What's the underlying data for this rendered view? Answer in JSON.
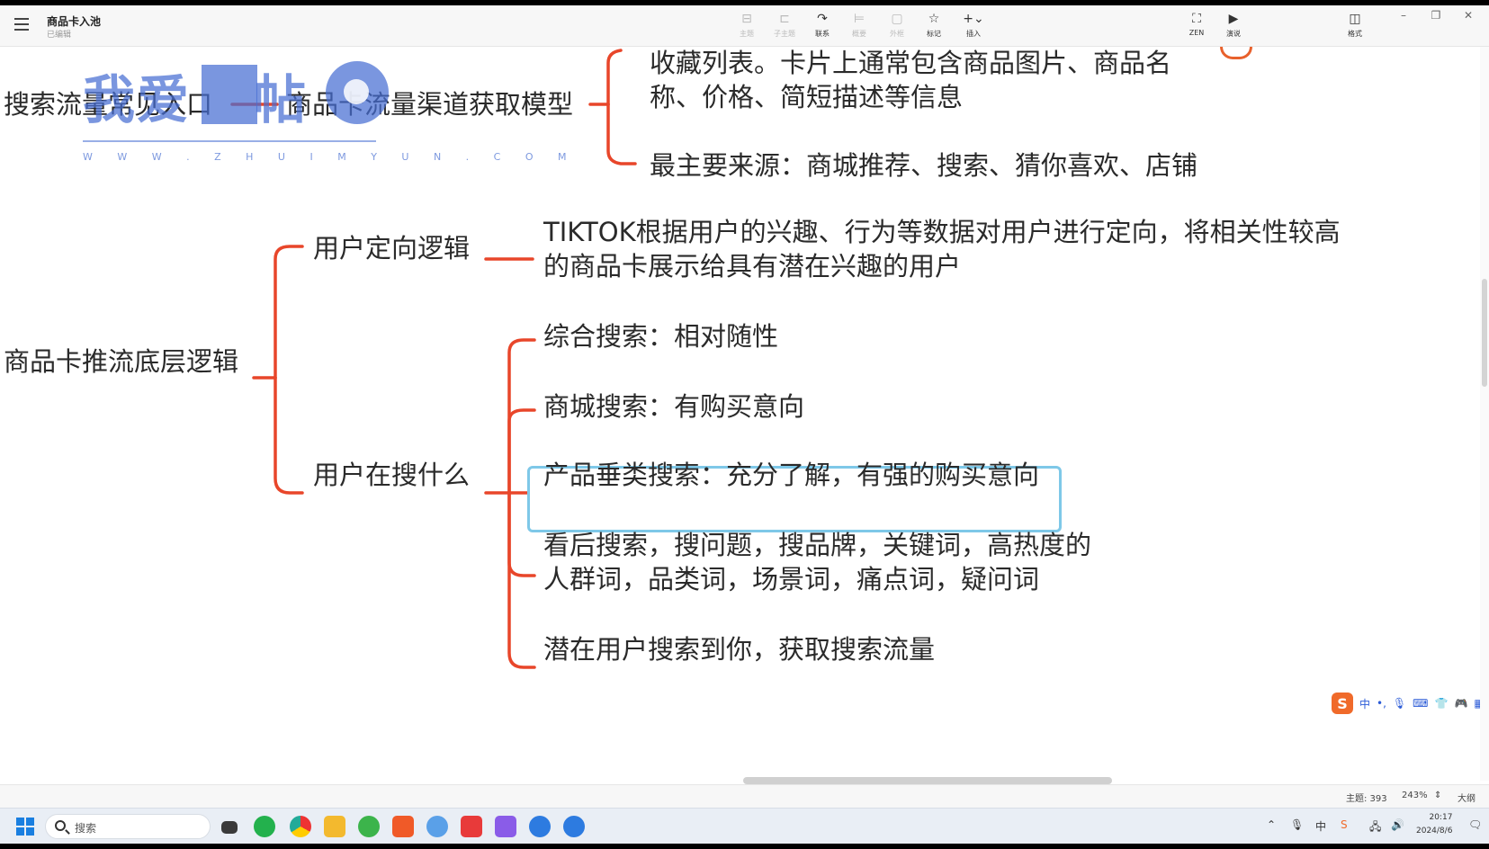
{
  "app": {
    "doc_title": "商品卡入池",
    "doc_status": "已编辑"
  },
  "toolbar": {
    "items": [
      {
        "icon": "topic-icon",
        "label": "主题",
        "enabled": false
      },
      {
        "icon": "subtopic-icon",
        "label": "子主题",
        "enabled": false
      },
      {
        "icon": "relation-icon",
        "label": "联系",
        "enabled": true
      },
      {
        "icon": "summary-icon",
        "label": "概要",
        "enabled": false
      },
      {
        "icon": "boundary-icon",
        "label": "外框",
        "enabled": false
      },
      {
        "icon": "marker-icon",
        "label": "标记",
        "enabled": true
      },
      {
        "icon": "insert-icon",
        "label": "插入",
        "enabled": true
      }
    ],
    "zen_label": "ZEN",
    "present_label": "演说",
    "format_label": "格式"
  },
  "mindmap": {
    "branch1": {
      "root": "搜索流量常见入口",
      "child": "商品卡流量渠道获取模型",
      "detail_line1": "收藏列表。卡片上通常包含商品图片、商品名",
      "detail_line2": "称、价格、简短描述等信息",
      "sources": "最主要来源：商城推荐、搜索、猜你喜欢、店铺"
    },
    "branch2": {
      "root": "商品卡推流底层逻辑",
      "targeting": {
        "label": "用户定向逻辑",
        "line1": "TIKTOK根据用户的兴趣、行为等数据对用户进行定向，将相关性较高",
        "line2": "的商品卡展示给具有潜在兴趣的用户"
      },
      "search": {
        "label": "用户在搜什么",
        "items": [
          "综合搜索：相对随性",
          "商城搜索：有购买意向",
          "产品垂类搜索：充分了解，有强的购买意向",
          "看后搜索，搜问题，搜品牌，关键词，高热度的",
          "人群词，品类词，场景词，痛点词，疑问词",
          "潜在用户搜索到你，获取搜索流量"
        ],
        "selected_index": 2
      }
    },
    "line_color": "#e8462a"
  },
  "watermark": {
    "text": "我爱",
    "text2": "帖",
    "url": "W W W . Z H U I M Y U N . C O M"
  },
  "statusbar": {
    "topic_count": "主题: 393",
    "zoom": "243%",
    "outline": "大纲"
  },
  "ime": {
    "mode": "中"
  },
  "taskbar": {
    "search_label": "搜索",
    "time": "20:17",
    "date": "2024/8/6",
    "lang": "中"
  }
}
